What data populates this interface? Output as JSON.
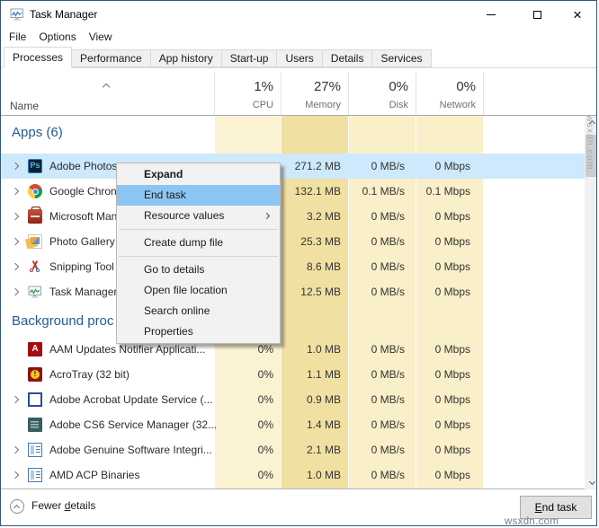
{
  "window": {
    "title": "Task Manager",
    "controls": [
      "minimize",
      "maximize",
      "close"
    ]
  },
  "menu_bar": {
    "items": [
      "File",
      "Options",
      "View"
    ]
  },
  "tab_bar": {
    "tabs": [
      {
        "label": "Processes",
        "active": true
      },
      {
        "label": "Performance",
        "active": false
      },
      {
        "label": "App history",
        "active": false
      },
      {
        "label": "Start-up",
        "active": false
      },
      {
        "label": "Users",
        "active": false
      },
      {
        "label": "Details",
        "active": false
      },
      {
        "label": "Services",
        "active": false
      }
    ]
  },
  "column_header": {
    "name": "Name",
    "sort": "ascending",
    "columns": [
      {
        "percent": "1%",
        "label": "CPU"
      },
      {
        "percent": "27%",
        "label": "Memory"
      },
      {
        "percent": "0%",
        "label": "Disk"
      },
      {
        "percent": "0%",
        "label": "Network"
      }
    ]
  },
  "process_table": {
    "groups": [
      {
        "label": "Apps (6)",
        "rows": [
          {
            "icon": "photoshop",
            "chevron": true,
            "name": "Adobe Photos",
            "cpu": "",
            "memory": "271.2 MB",
            "disk": "0 MB/s",
            "network": "0 Mbps",
            "selected": true
          },
          {
            "icon": "chrome",
            "chevron": true,
            "name": "Google Chron",
            "cpu": "",
            "memory": "132.1 MB",
            "disk": "0.1 MB/s",
            "network": "0.1 Mbps",
            "selected": false
          },
          {
            "icon": "mmc",
            "chevron": true,
            "name": "Microsoft Man",
            "cpu": "",
            "memory": "3.2 MB",
            "disk": "0 MB/s",
            "network": "0 Mbps",
            "selected": false
          },
          {
            "icon": "gallery",
            "chevron": true,
            "name": "Photo Gallery",
            "cpu": "",
            "memory": "25.3 MB",
            "disk": "0 MB/s",
            "network": "0 Mbps",
            "selected": false
          },
          {
            "icon": "snip",
            "chevron": true,
            "name": "Snipping Tool",
            "cpu": "",
            "memory": "8.6 MB",
            "disk": "0 MB/s",
            "network": "0 Mbps",
            "selected": false
          },
          {
            "icon": "taskmgr",
            "chevron": true,
            "name": "Task Manager",
            "cpu": "",
            "memory": "12.5 MB",
            "disk": "0 MB/s",
            "network": "0 Mbps",
            "selected": false
          }
        ]
      },
      {
        "label": "Background proc",
        "rows": [
          {
            "icon": "adobe-a",
            "chevron": false,
            "name": "AAM Updates Notifier Applicati...",
            "cpu": "0%",
            "memory": "1.0 MB",
            "disk": "0 MB/s",
            "network": "0 Mbps",
            "selected": false
          },
          {
            "icon": "acrotray",
            "chevron": false,
            "name": "AcroTray (32 bit)",
            "cpu": "0%",
            "memory": "1.1 MB",
            "disk": "0 MB/s",
            "network": "0 Mbps",
            "selected": false
          },
          {
            "icon": "outline",
            "chevron": true,
            "name": "Adobe Acrobat Update Service (...",
            "cpu": "0%",
            "memory": "0.9 MB",
            "disk": "0 MB/s",
            "network": "0 Mbps",
            "selected": false
          },
          {
            "icon": "cs6",
            "chevron": false,
            "name": "Adobe CS6 Service Manager (32...",
            "cpu": "0%",
            "memory": "1.4 MB",
            "disk": "0 MB/s",
            "network": "0 Mbps",
            "selected": false
          },
          {
            "icon": "winapp",
            "chevron": true,
            "name": "Adobe Genuine Software Integri...",
            "cpu": "0%",
            "memory": "2.1 MB",
            "disk": "0 MB/s",
            "network": "0 Mbps",
            "selected": false
          },
          {
            "icon": "winapp",
            "chevron": true,
            "name": "AMD ACP Binaries",
            "cpu": "0%",
            "memory": "1.0 MB",
            "disk": "0 MB/s",
            "network": "0 Mbps",
            "selected": false
          }
        ]
      }
    ]
  },
  "context_menu": {
    "items": [
      {
        "label": "Expand",
        "bold": true
      },
      {
        "label": "End task",
        "highlighted": true
      },
      {
        "label": "Resource values",
        "submenu": true
      },
      {
        "separator": true
      },
      {
        "label": "Create dump file"
      },
      {
        "separator": true
      },
      {
        "label": "Go to details"
      },
      {
        "label": "Open file location"
      },
      {
        "label": "Search online"
      },
      {
        "label": "Properties"
      }
    ]
  },
  "footer": {
    "fewer_prefix": "Fewer ",
    "fewer_key": "d",
    "fewer_suffix": "etails",
    "end_key": "E",
    "end_suffix": "nd task"
  },
  "watermark": {
    "text": "wsxdn.com"
  },
  "colors": {
    "selection": "#cde9fb",
    "menu_highlight": "#8cc5f2",
    "cpu_column": "#fbf2d2",
    "memory_column": "#f0e0a2",
    "disk_column": "#f9efc9",
    "network_column": "#f9efc9",
    "group_text": "#1e5c99",
    "window_border": "#33567d"
  }
}
